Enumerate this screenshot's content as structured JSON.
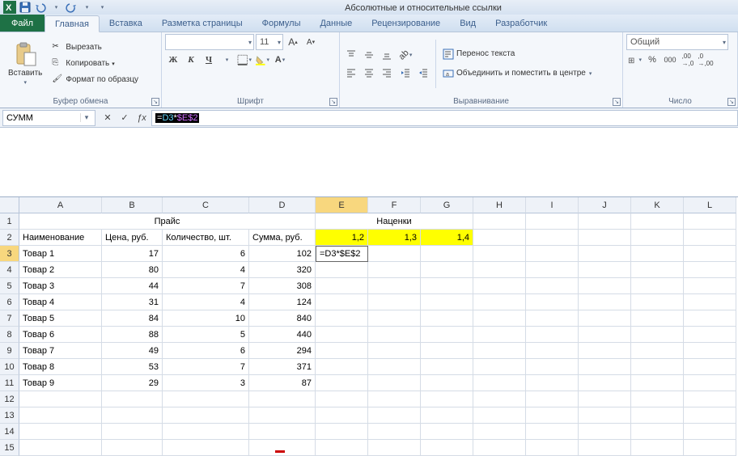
{
  "titlebar": {
    "title": "Абсолютные и относительные ссылки"
  },
  "tabs": {
    "file": "Файл",
    "items": [
      "Главная",
      "Вставка",
      "Разметка страницы",
      "Формулы",
      "Данные",
      "Рецензирование",
      "Вид",
      "Разработчик"
    ],
    "active": 0
  },
  "ribbon": {
    "clipboard": {
      "label": "Буфер обмена",
      "paste": "Вставить",
      "cut": "Вырезать",
      "copy": "Копировать",
      "format_painter": "Формат по образцу"
    },
    "font": {
      "label": "Шрифт",
      "font_name": "",
      "font_size": "11"
    },
    "alignment": {
      "label": "Выравнивание",
      "wrap": "Перенос текста",
      "merge": "Объединить и поместить в центре"
    },
    "number": {
      "label": "Число",
      "format": "Общий"
    }
  },
  "formula_bar": {
    "name_box": "СУММ",
    "formula_prefix": "=",
    "formula_ref1": "D3",
    "formula_op": "*",
    "formula_ref2": "$E$2"
  },
  "columns": [
    "A",
    "B",
    "C",
    "D",
    "E",
    "F",
    "G",
    "H",
    "I",
    "J",
    "K",
    "L"
  ],
  "grid": {
    "row1": {
      "price_title": "Прайс",
      "markup_title": "Наценки"
    },
    "row2": {
      "A": "Наименование",
      "B": "Цена, руб.",
      "C": "Количество, шт.",
      "D": "Сумма, руб.",
      "E": "1,2",
      "F": "1,3",
      "G": "1,4"
    },
    "data": [
      {
        "A": "Товар 1",
        "B": "17",
        "C": "6",
        "D": "102"
      },
      {
        "A": "Товар 2",
        "B": "80",
        "C": "4",
        "D": "320"
      },
      {
        "A": "Товар 3",
        "B": "44",
        "C": "7",
        "D": "308"
      },
      {
        "A": "Товар 4",
        "B": "31",
        "C": "4",
        "D": "124"
      },
      {
        "A": "Товар 5",
        "B": "84",
        "C": "10",
        "D": "840"
      },
      {
        "A": "Товар 6",
        "B": "88",
        "C": "5",
        "D": "440"
      },
      {
        "A": "Товар 7",
        "B": "49",
        "C": "6",
        "D": "294"
      },
      {
        "A": "Товар 8",
        "B": "53",
        "C": "7",
        "D": "371"
      },
      {
        "A": "Товар 9",
        "B": "29",
        "C": "3",
        "D": "87"
      }
    ],
    "edit_cell": "=D3*$E$2",
    "active_col": "E",
    "active_row": 3,
    "last_row": 15
  }
}
